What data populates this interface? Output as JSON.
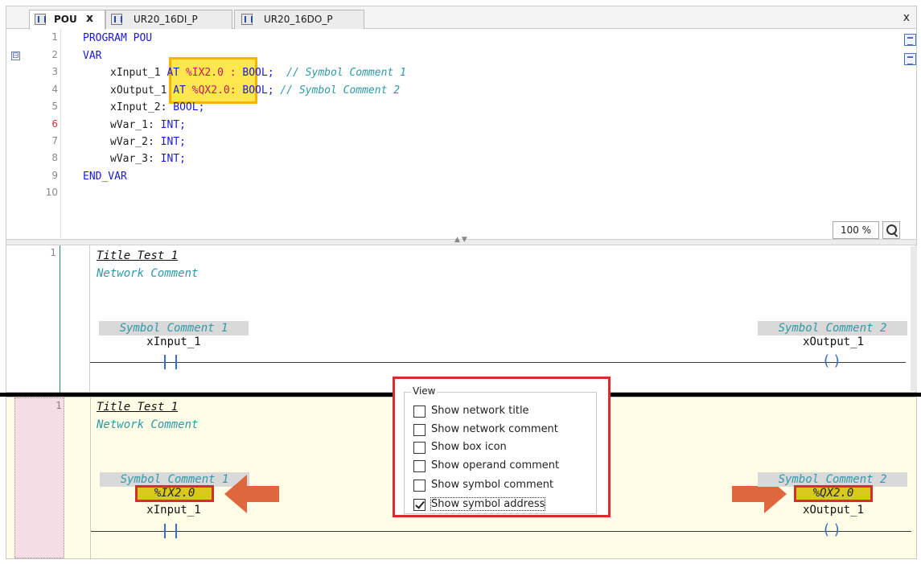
{
  "tabs": [
    {
      "label": "POU",
      "active": true,
      "close": "x"
    },
    {
      "label": "UR20_16DI_P",
      "active": false
    },
    {
      "label": "UR20_16DO_P",
      "active": false
    }
  ],
  "tab_overflow": "x",
  "declaration": {
    "line_numbers": [
      "1",
      "2",
      "3",
      "4",
      "5",
      "6",
      "7",
      "8",
      "9",
      "10"
    ],
    "lines": {
      "l1_kw": "PROGRAM POU",
      "l2_kw": "VAR",
      "l3_var": "xInput_1 ",
      "l3_at": "AT ",
      "l3_addr": "%IX2.0 :",
      "l3_type": " BOOL;",
      "l3_cmt": "  // Symbol Comment 1",
      "l4_var": "xOutput_1 ",
      "l4_at": "AT ",
      "l4_addr": "%QX2.0:",
      "l4_type": " BOOL;",
      "l4_cmt": " // Symbol Comment 2",
      "l5_var": "xInput_2: ",
      "l5_type": "BOOL;",
      "l6_var": "wVar_1: ",
      "l6_type": "INT;",
      "l7_var": "wVar_2: ",
      "l7_type": "INT;",
      "l8_var": "wVar_3: ",
      "l8_type": "INT;",
      "l9_kw": "END_VAR"
    },
    "fold_symbol": "⊟",
    "zoom": "100 %"
  },
  "network_top": {
    "number": "1",
    "title": "Title Test 1",
    "comment": "Network Comment",
    "left": {
      "symbol_comment": "Symbol Comment 1",
      "var": "xInput_1"
    },
    "right": {
      "symbol_comment": "Symbol Comment 2",
      "var": "xOutput_1"
    }
  },
  "network_bottom": {
    "number": "1",
    "title": "Title Test 1",
    "comment": "Network Comment",
    "left": {
      "symbol_comment": "Symbol Comment 1",
      "address": "%IX2.0",
      "var": "xInput_1"
    },
    "right": {
      "symbol_comment": "Symbol Comment 2",
      "address": "%QX2.0",
      "var": "xOutput_1"
    }
  },
  "view_popup": {
    "legend": "View",
    "options": [
      {
        "label": "Show network title",
        "checked": false
      },
      {
        "label": "Show network comment",
        "checked": false
      },
      {
        "label": "Show box icon",
        "checked": false
      },
      {
        "label": "Show operand comment",
        "checked": false
      },
      {
        "label": "Show symbol comment",
        "checked": false
      },
      {
        "label": "Show symbol address",
        "checked": true
      }
    ]
  },
  "colors": {
    "keyword": "#1a1ad6",
    "address": "#c2185b",
    "comment": "#2e9aa8",
    "highlight_border": "#f5b400",
    "highlight_fill": "#ffe63c",
    "callout_red": "#d32f2f",
    "arrow_orange": "#e0663e",
    "address_fill": "#d8c91a",
    "bottom_bg": "#fffde6"
  },
  "icons": {
    "tab_pou": "pou-icon",
    "tab_device": "device-icon",
    "zoom": "zoom-magnifier-icon",
    "side_1": "declaration-view-icon",
    "side_2": "table-view-icon",
    "arrow_left": "arrow-left-icon",
    "arrow_right": "arrow-right-icon"
  }
}
